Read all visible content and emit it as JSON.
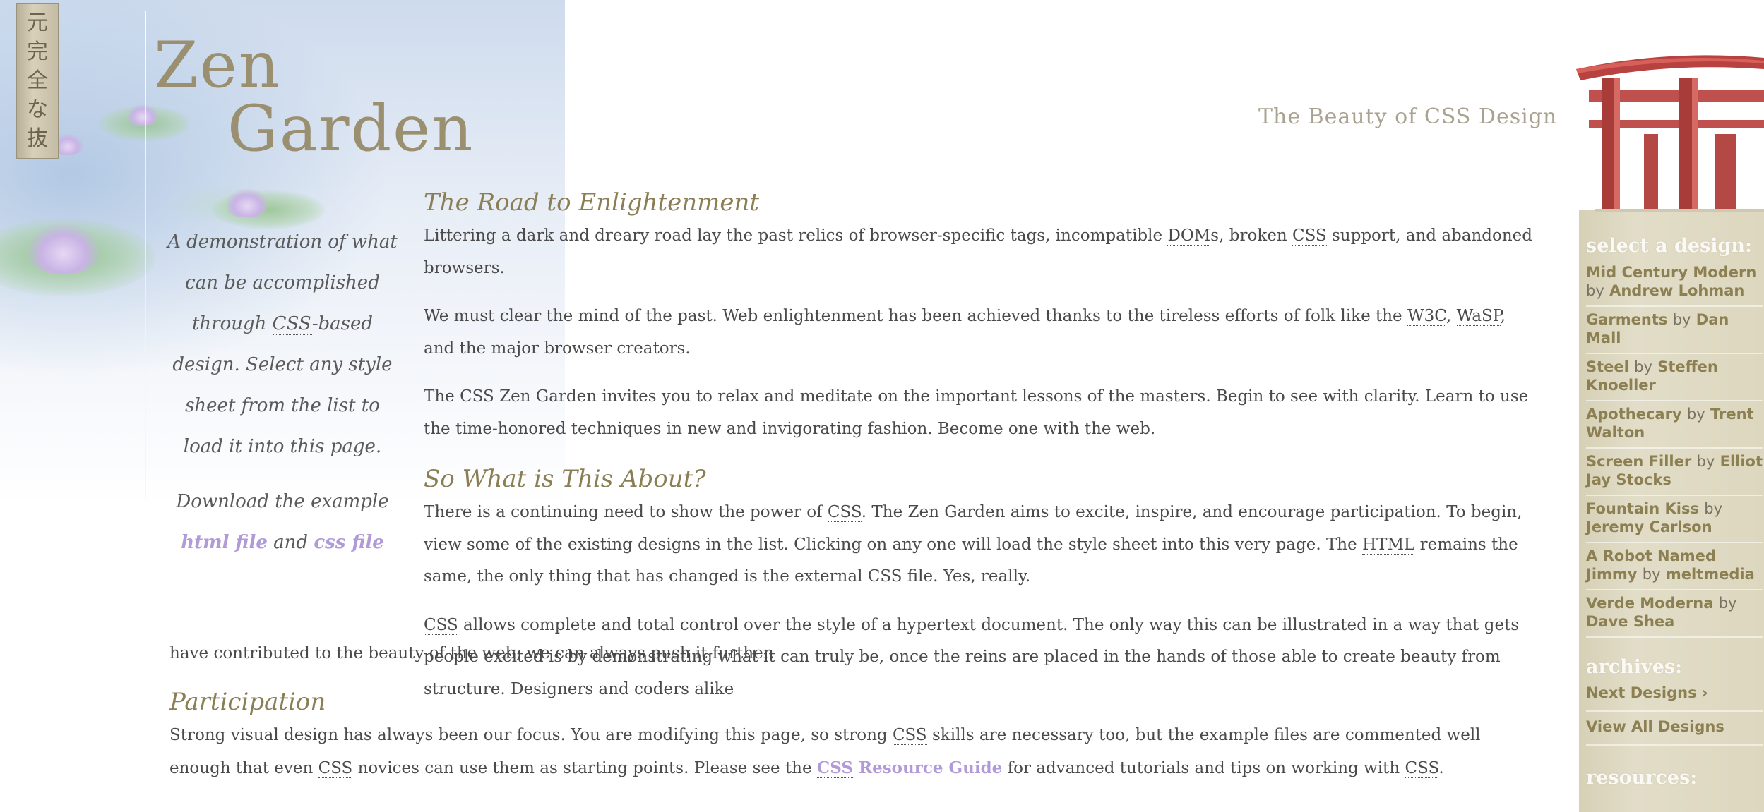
{
  "header": {
    "kanji": [
      "元",
      "完",
      "全",
      "な",
      "抜"
    ],
    "logo_line1": "Zen",
    "logo_line2": "Garden",
    "tagline": "The Beauty of CSS Design"
  },
  "intro": {
    "summary_parts": [
      "A demonstration of what can be accomplished through ",
      "CSS",
      "-based design. Select any style sheet from the list to load it into this page."
    ],
    "download_text": "Download the example",
    "html_link": "html file",
    "and_text": "and",
    "css_link": "css file"
  },
  "main": {
    "road_title": "The Road to Enlightenment",
    "road_p1_parts": [
      "Littering a dark and dreary road lay the past relics of browser-specific tags, incompatible ",
      "DOM",
      "s, broken ",
      "CSS",
      " support, and abandoned browsers."
    ],
    "road_p2_parts": [
      "We must clear the mind of the past. Web enlightenment has been achieved thanks to the tireless efforts of folk like the ",
      "W3C",
      ", ",
      "WaSP",
      ", and the major browser creators."
    ],
    "road_p3": "The CSS Zen Garden invites you to relax and meditate on the important lessons of the masters. Begin to see with clarity. Learn to use the time-honored techniques in new and invigorating fashion. Become one with the web.",
    "about_title": "So What is This About?",
    "about_p1_parts": [
      "There is a continuing need to show the power of ",
      "CSS",
      ". The Zen Garden aims to excite, inspire, and encourage participation. To begin, view some of the existing designs in the list. Clicking on any one will load the style sheet into this very page. The ",
      "HTML",
      " remains the same, the only thing that has changed is the external ",
      "CSS",
      " file. Yes, really."
    ],
    "about_p2_parts": [
      "CSS",
      " allows complete and total control over the style of a hypertext document. The only way this can be illustrated in a way that gets people excited is by demonstrating what it can truly be, once the reins are placed in the hands of those able to create beauty from structure. Designers and coders alike"
    ],
    "about_p2_continued": "have contributed to the beauty of the web; we can always push it further.",
    "participation_title": "Participation",
    "participation_p1_parts": [
      "Strong visual design has always been our focus. You are modifying this page, so strong ",
      "CSS",
      " skills are necessary too, but the example files are commented well enough that even ",
      "CSS",
      " novices can use them as starting points. Please see the ",
      "CSS",
      " Resource Guide",
      " for advanced tutorials and tips on working with ",
      "CSS",
      "."
    ]
  },
  "sidebar": {
    "select_heading": "select a design:",
    "designs": [
      {
        "name": "Mid Century Modern",
        "by": "by",
        "author": "Andrew Lohman"
      },
      {
        "name": "Garments",
        "by": "by",
        "author": "Dan Mall"
      },
      {
        "name": "Steel",
        "by": "by",
        "author": "Steffen Knoeller"
      },
      {
        "name": "Apothecary",
        "by": "by",
        "author": "Trent Walton"
      },
      {
        "name": "Screen Filler",
        "by": "by",
        "author": "Elliot Jay Stocks"
      },
      {
        "name": "Fountain Kiss",
        "by": "by",
        "author": "Jeremy Carlson"
      },
      {
        "name": "A Robot Named Jimmy",
        "by": "by",
        "author": "meltmedia"
      },
      {
        "name": "Verde Moderna",
        "by": "by",
        "author": "Dave Shea"
      }
    ],
    "archives_heading": "archives:",
    "next_designs": "Next Designs ›",
    "view_all": "View All Designs",
    "resources_heading": "resources:"
  },
  "colors": {
    "link_purple": "#b19ad8",
    "heading_olive": "#8a7e54",
    "sidebar_bg": "#ddd7bf",
    "torii_red": "#c0504d"
  }
}
